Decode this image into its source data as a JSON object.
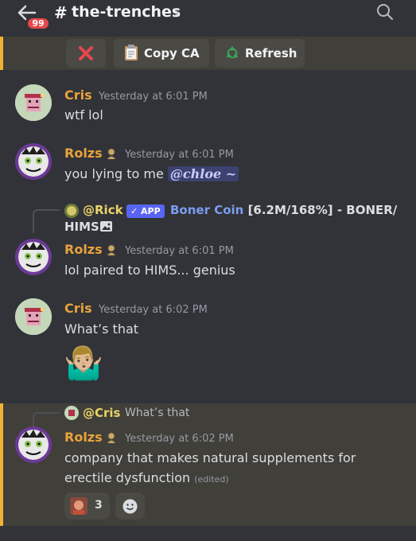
{
  "header": {
    "unread_count": "99",
    "hash": "#",
    "channel_name": "the-trenches",
    "chevron": "›"
  },
  "buttons": [
    {
      "label": "",
      "icon": "x-icon"
    },
    {
      "label": "Copy CA",
      "icon": "clipboard-icon"
    },
    {
      "label": "Refresh",
      "icon": "recycle-icon"
    }
  ],
  "messages": {
    "m1": {
      "author": "Cris",
      "timestamp": "Yesterday at 6:01 PM",
      "text": "wtf lol"
    },
    "m2": {
      "author": "Rolzs",
      "timestamp": "Yesterday at 6:01 PM",
      "text": "you lying to me ",
      "mention": "@𝒄𝒉𝒍𝒐𝒆 ~"
    },
    "m3": {
      "reply": {
        "author": "@Rick",
        "app_tag": "✓ APP",
        "coin": "Boner Coin",
        "text1": " [6.2M/168%] - BONER/",
        "text2": "HIMS"
      },
      "author": "Rolzs",
      "timestamp": "Yesterday at 6:01 PM",
      "text": "lol paired to HIMS... genius"
    },
    "m4": {
      "author": "Cris",
      "timestamp": "Yesterday at 6:02 PM",
      "text": "What’s that",
      "emoji": "🤷🏼‍♂️"
    },
    "m5": {
      "reply": {
        "author": "@Cris",
        "text": "What’s that"
      },
      "author": "Rolzs",
      "timestamp": "Yesterday at 6:02 PM",
      "line1": "company that makes natural supplements for",
      "line2": "erectile dysfunction",
      "edited": "(edited)",
      "reaction_count": "3"
    }
  },
  "colors": {
    "background": "#313338",
    "highlight": "#403f39",
    "highlight_border": "#f0b232",
    "username": "#e9a23b",
    "app_badge": "#5865f2",
    "reply_name": "#ead36b"
  }
}
